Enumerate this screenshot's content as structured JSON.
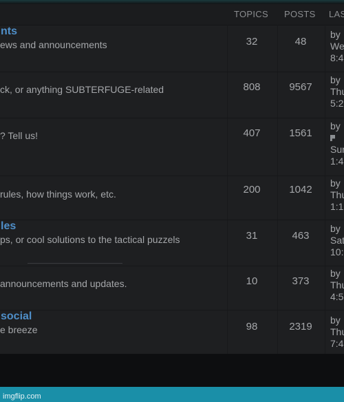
{
  "header": {
    "topics": "TOPICS",
    "posts": "POSTS",
    "last": "LAS"
  },
  "rows": [
    {
      "title": "nts",
      "desc": "ews and announcements",
      "topics": "32",
      "posts": "48",
      "last": [
        "by",
        "We",
        "8:4"
      ]
    },
    {
      "title": "",
      "desc": "ck, or anything SUBTERFUGE-related",
      "topics": "808",
      "posts": "9567",
      "last": [
        "by",
        "Thu",
        "5:2"
      ]
    },
    {
      "title": "",
      "desc": "? Tell us!",
      "topics": "407",
      "posts": "1561",
      "last": [
        "by",
        "",
        "Sur",
        "1:4"
      ]
    },
    {
      "title": "",
      "desc": "rules, how things work, etc.",
      "topics": "200",
      "posts": "1042",
      "last": [
        "by",
        "Thu",
        "1:1"
      ]
    },
    {
      "title": "les",
      "desc": "ps, or cool solutions to the tactical puzzels",
      "topics": "31",
      "posts": "463",
      "last": [
        "by",
        "Sat",
        "10:"
      ]
    },
    {
      "title": "",
      "desc": "announcements and updates.",
      "topics": "10",
      "posts": "373",
      "last": [
        "by",
        "Thu",
        "4:5"
      ]
    },
    {
      "title": " social",
      "desc": "e breeze",
      "topics": "98",
      "posts": "2319",
      "last": [
        "by",
        "Thu",
        "7:4"
      ]
    }
  ],
  "watermark": "imgflip.com"
}
